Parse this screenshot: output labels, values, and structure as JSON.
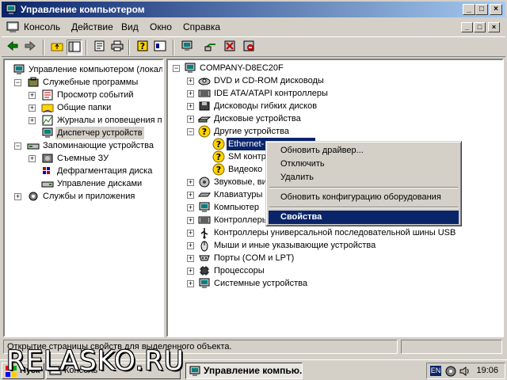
{
  "window": {
    "title": "Управление компьютером",
    "buttons": [
      "_",
      "□",
      "×"
    ]
  },
  "menu": {
    "items": [
      "Консоль",
      "Действие",
      "Вид",
      "Окно",
      "Справка"
    ],
    "mdi_buttons": [
      "_",
      "□",
      "×"
    ]
  },
  "toolbar": {
    "icons": [
      "back-arrow-icon",
      "forward-arrow-icon",
      "up-folder-icon",
      "show-tree-icon",
      "properties-icon",
      "print-icon",
      "help-icon",
      "show-hide-icon",
      "scan-hardware-icon",
      "uninstall-icon",
      "disable-icon"
    ]
  },
  "left_tree": {
    "items": [
      {
        "label": "Управление компьютером (локаль",
        "level": 0,
        "expander": ""
      },
      {
        "label": "Служебные программы",
        "level": 1,
        "expander": "−"
      },
      {
        "label": "Просмотр событий",
        "level": 2,
        "expander": "+"
      },
      {
        "label": "Общие папки",
        "level": 2,
        "expander": "+"
      },
      {
        "label": "Журналы и оповещения пр",
        "level": 2,
        "expander": "+"
      },
      {
        "label": "Диспетчер устройств",
        "level": 2,
        "expander": ""
      },
      {
        "label": "Запоминающие устройства",
        "level": 1,
        "expander": "−"
      },
      {
        "label": "Съемные ЗУ",
        "level": 2,
        "expander": "+"
      },
      {
        "label": "Дефрагментация диска",
        "level": 2,
        "expander": ""
      },
      {
        "label": "Управление дисками",
        "level": 2,
        "expander": ""
      },
      {
        "label": "Службы и приложения",
        "level": 1,
        "expander": "+"
      }
    ]
  },
  "right_tree": {
    "items": [
      {
        "label": "COMPANY-D8EC20F",
        "level": 0,
        "expander": "−"
      },
      {
        "label": "DVD и CD-ROM дисководы",
        "level": 1,
        "expander": "+"
      },
      {
        "label": "IDE ATA/ATAPI контроллеры",
        "level": 1,
        "expander": "+"
      },
      {
        "label": "Дисководы гибких дисков",
        "level": 1,
        "expander": "+"
      },
      {
        "label": "Дисковые устройства",
        "level": 1,
        "expander": "+"
      },
      {
        "label": "Другие устройства",
        "level": 1,
        "expander": "−"
      },
      {
        "label": "Ethernet-",
        "level": 2,
        "expander": ""
      },
      {
        "label": "SM контр",
        "level": 2,
        "expander": ""
      },
      {
        "label": "Видеоко",
        "level": 2,
        "expander": ""
      },
      {
        "label": "Звуковые, ви",
        "level": 1,
        "expander": "+"
      },
      {
        "label": "Клавиатуры",
        "level": 1,
        "expander": "+"
      },
      {
        "label": "Компьютер",
        "level": 1,
        "expander": "+"
      },
      {
        "label": "Контроллеры",
        "level": 1,
        "expander": "+"
      },
      {
        "label": "Контроллеры универсальной последовательной шины USB",
        "level": 1,
        "expander": "+"
      },
      {
        "label": "Мыши и иные указывающие устройства",
        "level": 1,
        "expander": "+"
      },
      {
        "label": "Порты (COM и LPT)",
        "level": 1,
        "expander": "+"
      },
      {
        "label": "Процессоры",
        "level": 1,
        "expander": "+"
      },
      {
        "label": "Системные устройства",
        "level": 1,
        "expander": "+"
      }
    ]
  },
  "context_menu": {
    "items": [
      "Обновить драйвер...",
      "Отключить",
      "Удалить",
      "Обновить конфигурацию оборудования",
      "Свойства"
    ]
  },
  "status": {
    "text": "Открытие страницы свойств для выделенного объекта."
  },
  "taskbar": {
    "start_label": "Пуск",
    "tasks": [
      "Консоль",
      "Управление компью..."
    ],
    "lang": "EN",
    "clock": "19:06"
  },
  "watermark": "RELASKO.RU",
  "colors": {
    "face": "#d4d0c8",
    "title_start": "#0a246a",
    "title_end": "#a6caf0",
    "selection": "#0a246a",
    "warning": "#ffd400"
  }
}
